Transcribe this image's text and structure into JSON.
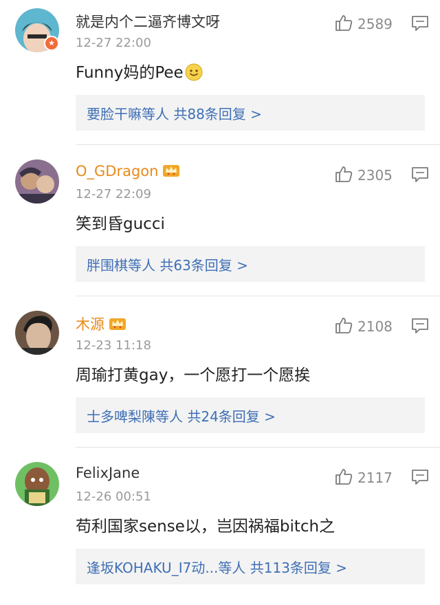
{
  "comments": [
    {
      "username": "就是内个二逼齐博文呀",
      "time": "12-27 22:00",
      "text": "Funny妈的Pee",
      "likes": "2589",
      "replies_text": "要脸干嘛等人  共88条回复 >",
      "avatar_colors": [
        "#5fb6cf",
        "#2a2a2a",
        "#f1d2bd"
      ],
      "username_color": "#333333",
      "verified_badge": true,
      "crown": false,
      "emoji": "smile-emoji"
    },
    {
      "username": "O_GDragon",
      "time": "12-27 22:09",
      "text": "笑到昏gucci",
      "likes": "2305",
      "replies_text": "胖围棋等人  共63条回复 >",
      "avatar_colors": [
        "#8a6f8f",
        "#c9a07f",
        "#3b3348"
      ],
      "username_color": "#e88a1a",
      "verified_badge": false,
      "crown": true
    },
    {
      "username": "木源",
      "time": "12-23 11:18",
      "text": "周瑜打黄gay，一个愿打一个愿挨",
      "likes": "2108",
      "replies_text": "士多啤梨陳等人  共24条回复 >",
      "avatar_colors": [
        "#d7b9a0",
        "#1c1c1c",
        "#6b5444"
      ],
      "username_color": "#e88a1a",
      "verified_badge": false,
      "crown": true
    },
    {
      "username": "FelixJane",
      "time": "12-26 00:51",
      "text": "苟利国家sense以，岂因祸福bitch之",
      "likes": "2117",
      "replies_text": "逢坂KOHAKU_I7动...等人  共113条回复 >",
      "avatar_colors": [
        "#6fbf63",
        "#8c5a3a",
        "#3a6f2f"
      ],
      "username_color": "#333333",
      "verified_badge": false,
      "crown": false
    }
  ],
  "colors": {
    "link_blue": "#3f6fb5",
    "meta_gray": "#9a9a9a",
    "gold": "#e88a1a",
    "reply_bg": "#f3f3f3"
  },
  "icons": {
    "like": "thumbs-up-icon",
    "reply": "comment-icon",
    "crown": "crown-icon",
    "verified": "verified-badge-icon"
  }
}
